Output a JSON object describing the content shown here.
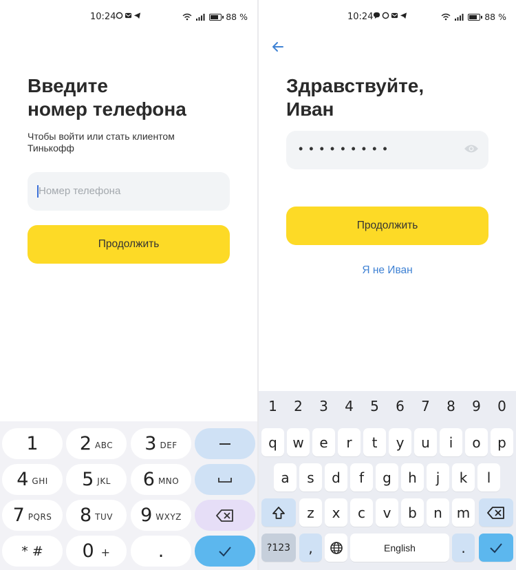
{
  "left_screen": {
    "status_bar": {
      "time": "10:24",
      "battery": "88 %"
    },
    "title": "Введите\nномер телефона",
    "subtitle": "Чтобы войти или стать клиентом Тинькофф",
    "phone_placeholder": "Номер телефона",
    "continue_label": "Продолжить",
    "keypad": {
      "keys": [
        {
          "digit": "1",
          "letters": ""
        },
        {
          "digit": "2",
          "letters": "ABC"
        },
        {
          "digit": "3",
          "letters": "DEF"
        },
        {
          "digit": "4",
          "letters": "GHI"
        },
        {
          "digit": "5",
          "letters": "JKL"
        },
        {
          "digit": "6",
          "letters": "MNO"
        },
        {
          "digit": "7",
          "letters": "PQRS"
        },
        {
          "digit": "8",
          "letters": "TUV"
        },
        {
          "digit": "9",
          "letters": "WXYZ"
        },
        {
          "digit": "* #",
          "letters": ""
        },
        {
          "digit": "0",
          "letters": "+"
        },
        {
          "digit": ".",
          "letters": ""
        }
      ],
      "side_keys": [
        "minus",
        "space",
        "backspace",
        "enter"
      ]
    }
  },
  "right_screen": {
    "status_bar": {
      "time": "10:24",
      "battery": "88 %"
    },
    "title": "Здравствуйте,\nИван",
    "password_mask": "•••••••••",
    "continue_label": "Продолжить",
    "not_me_link": "Я не Иван",
    "keyboard": {
      "number_row": [
        "1",
        "2",
        "3",
        "4",
        "5",
        "6",
        "7",
        "8",
        "9",
        "0"
      ],
      "row1": [
        "q",
        "w",
        "e",
        "r",
        "t",
        "y",
        "u",
        "i",
        "o",
        "p"
      ],
      "row2": [
        "a",
        "s",
        "d",
        "f",
        "g",
        "h",
        "j",
        "k",
        "l"
      ],
      "row3": [
        "z",
        "x",
        "c",
        "v",
        "b",
        "n",
        "m"
      ],
      "symbols_key": "?123",
      "comma_key": ",",
      "space_label": "English",
      "period_key": "."
    }
  },
  "colors": {
    "accent_yellow": "#fdda26",
    "link_blue": "#3f82d4",
    "input_bg": "#f2f4f6",
    "enter_key": "#5cb7ee",
    "func_key": "#cfe1f5"
  }
}
